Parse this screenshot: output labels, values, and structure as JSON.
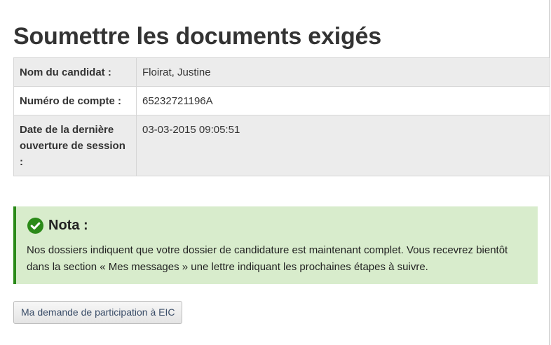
{
  "page": {
    "title": "Soumettre les documents exigés"
  },
  "candidate_info": {
    "rows": [
      {
        "label": "Nom du candidat :",
        "value": "Floirat, Justine"
      },
      {
        "label": "Numéro de compte :",
        "value": "65232721196A"
      },
      {
        "label": "Date de la dernière ouverture de session :",
        "value": "03-03-2015 09:05:51"
      }
    ]
  },
  "notice": {
    "icon": "check-circle-icon",
    "title": "Nota :",
    "text": "Nos dossiers indiquent que votre dossier de candidature est maintenant complet. Vous recevrez bientôt dans la section « Mes messages » une lettre indiquant les prochaines étapes à suivre.",
    "background_color": "#d8eccc",
    "accent_color": "#2b8a19"
  },
  "actions": {
    "participation_button_label": "Ma demande de participation à EIC"
  }
}
